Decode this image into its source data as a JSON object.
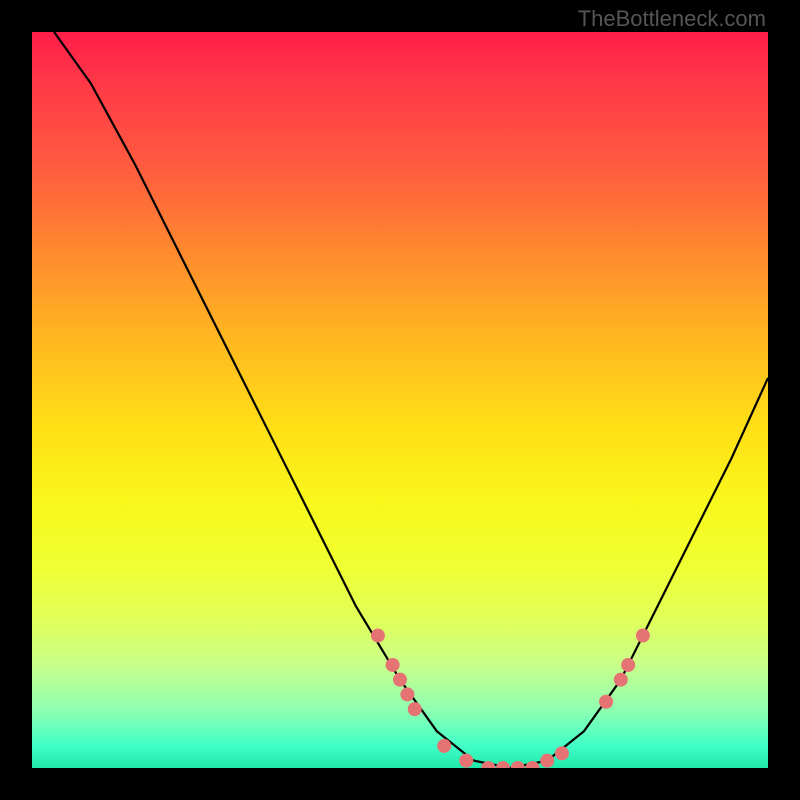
{
  "watermark": "TheBottleneck.com",
  "chart_data": {
    "type": "line",
    "title": "",
    "xlabel": "",
    "ylabel": "",
    "xlim": [
      0,
      100
    ],
    "ylim": [
      0,
      100
    ],
    "curve": [
      {
        "x": 3,
        "y": 100
      },
      {
        "x": 8,
        "y": 93
      },
      {
        "x": 14,
        "y": 82
      },
      {
        "x": 20,
        "y": 70
      },
      {
        "x": 26,
        "y": 58
      },
      {
        "x": 32,
        "y": 46
      },
      {
        "x": 38,
        "y": 34
      },
      {
        "x": 44,
        "y": 22
      },
      {
        "x": 50,
        "y": 12
      },
      {
        "x": 55,
        "y": 5
      },
      {
        "x": 60,
        "y": 1
      },
      {
        "x": 65,
        "y": 0
      },
      {
        "x": 70,
        "y": 1
      },
      {
        "x": 75,
        "y": 5
      },
      {
        "x": 80,
        "y": 12
      },
      {
        "x": 85,
        "y": 22
      },
      {
        "x": 90,
        "y": 32
      },
      {
        "x": 95,
        "y": 42
      },
      {
        "x": 100,
        "y": 53
      }
    ],
    "markers": [
      {
        "x": 47,
        "y": 18
      },
      {
        "x": 49,
        "y": 14
      },
      {
        "x": 50,
        "y": 12
      },
      {
        "x": 51,
        "y": 10
      },
      {
        "x": 52,
        "y": 8
      },
      {
        "x": 56,
        "y": 3
      },
      {
        "x": 59,
        "y": 1
      },
      {
        "x": 62,
        "y": 0
      },
      {
        "x": 64,
        "y": 0
      },
      {
        "x": 66,
        "y": 0
      },
      {
        "x": 68,
        "y": 0
      },
      {
        "x": 70,
        "y": 1
      },
      {
        "x": 72,
        "y": 2
      },
      {
        "x": 78,
        "y": 9
      },
      {
        "x": 80,
        "y": 12
      },
      {
        "x": 81,
        "y": 14
      },
      {
        "x": 83,
        "y": 18
      }
    ],
    "marker_color": "#e57373",
    "curve_color": "#000000"
  }
}
